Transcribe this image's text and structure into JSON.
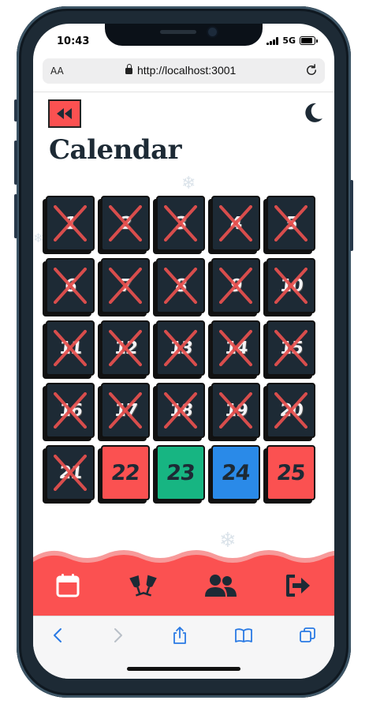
{
  "status": {
    "time": "10:43",
    "network": "5G"
  },
  "browser": {
    "text_size_label": "AA",
    "url": "http://localhost:3001"
  },
  "page": {
    "title": "Calendar"
  },
  "calendar": {
    "days": [
      {
        "label": "1",
        "state": "opened"
      },
      {
        "label": "2",
        "state": "opened"
      },
      {
        "label": "3",
        "state": "opened"
      },
      {
        "label": "4",
        "state": "opened"
      },
      {
        "label": "5",
        "state": "opened"
      },
      {
        "label": "6",
        "state": "opened"
      },
      {
        "label": "7",
        "state": "opened"
      },
      {
        "label": "8",
        "state": "opened"
      },
      {
        "label": "9",
        "state": "opened"
      },
      {
        "label": "10",
        "state": "opened"
      },
      {
        "label": "11",
        "state": "opened"
      },
      {
        "label": "12",
        "state": "opened"
      },
      {
        "label": "13",
        "state": "opened"
      },
      {
        "label": "14",
        "state": "opened"
      },
      {
        "label": "15",
        "state": "opened"
      },
      {
        "label": "16",
        "state": "opened"
      },
      {
        "label": "17",
        "state": "opened"
      },
      {
        "label": "18",
        "state": "opened"
      },
      {
        "label": "19",
        "state": "opened"
      },
      {
        "label": "20",
        "state": "opened"
      },
      {
        "label": "21",
        "state": "opened"
      },
      {
        "label": "22",
        "state": "available",
        "color": "#fb5151"
      },
      {
        "label": "23",
        "state": "available",
        "color": "#17b582"
      },
      {
        "label": "24",
        "state": "available",
        "color": "#2a8ae8"
      },
      {
        "label": "25",
        "state": "available",
        "color": "#fb5151"
      }
    ]
  },
  "colors": {
    "accent": "#fb5151",
    "dark": "#1d2a35",
    "cross": "#e8504e",
    "white": "#ffffff"
  },
  "nav": [
    {
      "name": "calendar-icon"
    },
    {
      "name": "cheers-icon"
    },
    {
      "name": "users-icon"
    },
    {
      "name": "logout-icon"
    }
  ]
}
